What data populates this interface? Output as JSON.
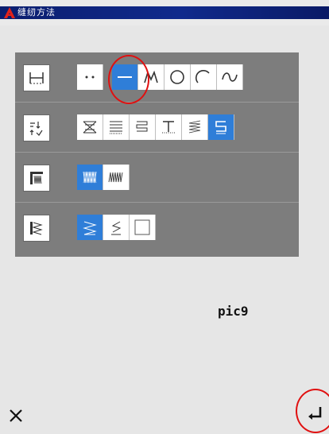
{
  "window": {
    "title": "缝纫方法",
    "logo_icon": "app-logo-icon",
    "accent_color": "#0b1e6f"
  },
  "rows": [
    {
      "category_icon": "stitch-length-icon",
      "options": [
        {
          "icon": "dot-dot-icon",
          "selected": false
        },
        {
          "icon": "straight-line-icon",
          "selected": true
        },
        {
          "icon": "m-zigzag-icon",
          "selected": false
        },
        {
          "icon": "circle-icon",
          "selected": false
        },
        {
          "icon": "arc-icon",
          "selected": false
        },
        {
          "icon": "wave-curve-icon",
          "selected": false
        }
      ]
    },
    {
      "category_icon": "direction-swap-icon",
      "options": [
        {
          "icon": "cross-hatch-icon",
          "selected": false
        },
        {
          "icon": "horizontal-lines-icon",
          "selected": false
        },
        {
          "icon": "serpentine-icon",
          "selected": false
        },
        {
          "icon": "tack-down-icon",
          "selected": false
        },
        {
          "icon": "diagonal-fill-icon",
          "selected": false
        },
        {
          "icon": "s-fill-icon",
          "selected": true
        }
      ]
    },
    {
      "category_icon": "satin-pattern-icon",
      "options": [
        {
          "icon": "double-zigzag-icon",
          "selected": true
        },
        {
          "icon": "single-zigzag-icon",
          "selected": false
        }
      ]
    },
    {
      "category_icon": "corner-pattern-icon",
      "options": [
        {
          "icon": "corner-zigzag-icon",
          "selected": true
        },
        {
          "icon": "corner-step-icon",
          "selected": false
        },
        {
          "icon": "empty-square-icon",
          "selected": false
        }
      ]
    }
  ],
  "preview_label": "pic9",
  "footer": {
    "close_icon": "close-icon",
    "enter_icon": "enter-return-icon"
  },
  "selection_color": "#2f7ed8",
  "highlight_ring_color": "#e01010"
}
